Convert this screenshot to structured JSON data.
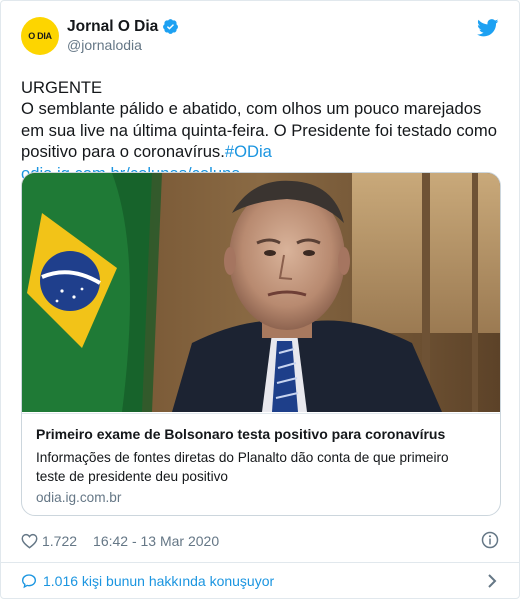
{
  "header": {
    "avatar_text": "O DIA",
    "display_name": "Jornal O Dia",
    "handle": "@jornalodia"
  },
  "tweet": {
    "line1": "URGENTE",
    "body": "O semblante pálido e abatido, com olhos um pouco marejados em sua live na última quinta-feira. O Presidente foi testado como positivo para o coronavírus.",
    "hashtag": "#ODia",
    "link": "odia.ig.com.br/colunas/coluna…"
  },
  "card": {
    "title": "Primeiro exame de Bolsonaro testa positivo para coronavírus",
    "description": "Informações de fontes diretas do Planalto dão conta de que primeiro teste de presidente deu positivo",
    "domain": "odia.ig.com.br"
  },
  "meta": {
    "likes": "1.722",
    "timestamp": "16:42 - 13 Mar 2020"
  },
  "footer": {
    "conversation": "1.016 kişi bunun hakkında konuşuyor"
  },
  "colors": {
    "link": "#1b95e0",
    "secondary": "#657786",
    "border": "#e1e8ed",
    "avatar_bg": "#fdd500"
  }
}
